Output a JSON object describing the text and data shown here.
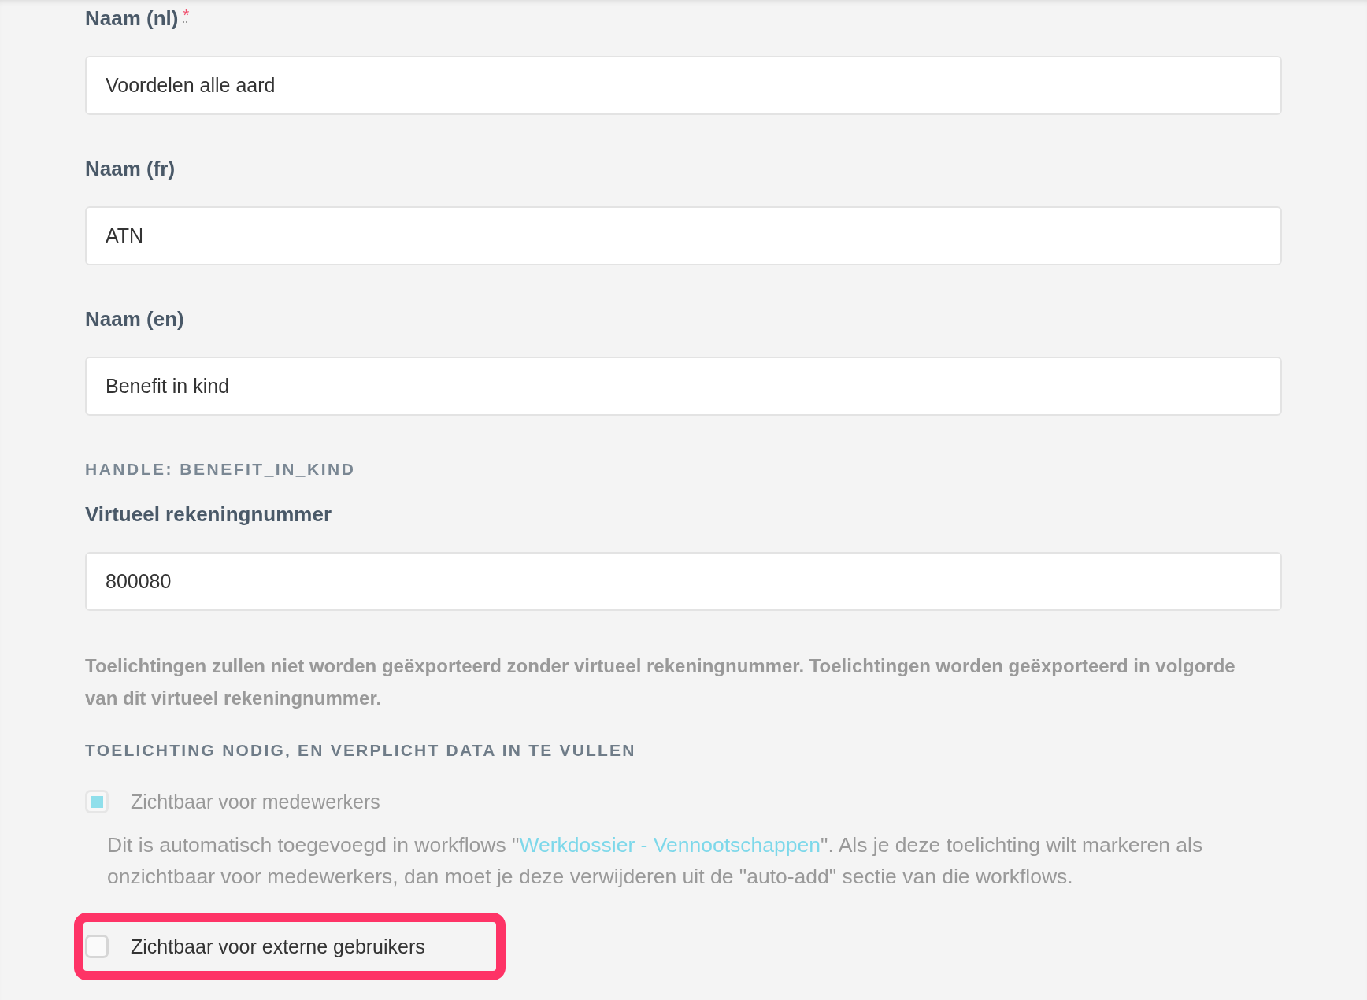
{
  "fields": [
    {
      "label": "Naam (nl)",
      "required_mark": "*",
      "value": "Voordelen alle aard"
    },
    {
      "label": "Naam (fr)",
      "value": "ATN"
    },
    {
      "label": "Naam (en)",
      "value": "Benefit in kind"
    }
  ],
  "handle": "HANDLE: BENEFIT_IN_KIND",
  "account": {
    "label": "Virtueel rekeningnummer",
    "value": "800080",
    "help": "Toelichtingen zullen niet worden geëxporteerd zonder virtueel rekeningnummer. Toelichtingen worden geëxporteerd in volgorde van dit virtueel rekeningnummer."
  },
  "section_heading": "TOELICHTING NODIG, EN VERPLICHT DATA IN TE VULLEN",
  "checkboxes": [
    {
      "label": "Zichtbaar voor medewerkers",
      "checked": true,
      "disabled": true,
      "highlighted": false,
      "note": {
        "before": "Dit is automatisch toegevoegd in workflows \"",
        "link": "Werkdossier - Vennootschappen",
        "after": "\". Als je deze toelichting wilt markeren als onzichtbaar voor medewerkers, dan moet je deze verwijderen uit de \"auto-add\" sectie van die workflows."
      }
    },
    {
      "label": "Zichtbaar voor externe gebruikers",
      "checked": false,
      "disabled": false,
      "highlighted": true
    }
  ]
}
